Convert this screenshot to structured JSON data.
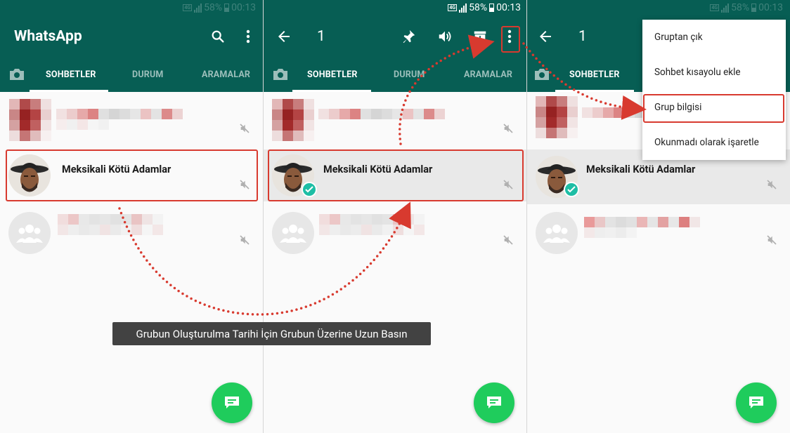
{
  "statusbar": {
    "network": "4G",
    "battery": "58%",
    "time": "00:13"
  },
  "panel1": {
    "app_title": "WhatsApp",
    "tabs": [
      "SOHBETLER",
      "DURUM",
      "ARAMALAR"
    ]
  },
  "panel2": {
    "selected_count": "1",
    "tabs": [
      "SOHBETLER",
      "DURUM",
      "ARAMALAR"
    ]
  },
  "panel3": {
    "selected_count": "1",
    "tabs": [
      "SOHBETLER"
    ]
  },
  "chat": {
    "name": "Meksikali Kötü Adamlar"
  },
  "menu": {
    "items": [
      "Gruptan çık",
      "Sohbet kısayolu ekle",
      "Grup bilgisi",
      "Okunmadı olarak işaretle"
    ]
  },
  "caption": "Grubun Oluşturulma Tarihi İçin Grubun Üzerine Uzun Basın",
  "colors": {
    "primary": "#075e54",
    "accent": "#1fcc5c",
    "check": "#1ebea5",
    "highlight": "#d83a2f"
  },
  "icons": [
    "search-icon",
    "more-vert-icon",
    "back-arrow-icon",
    "pin-icon",
    "volume-icon",
    "archive-icon",
    "camera-icon",
    "mute-icon",
    "new-chat-icon",
    "group-avatar-icon"
  ]
}
